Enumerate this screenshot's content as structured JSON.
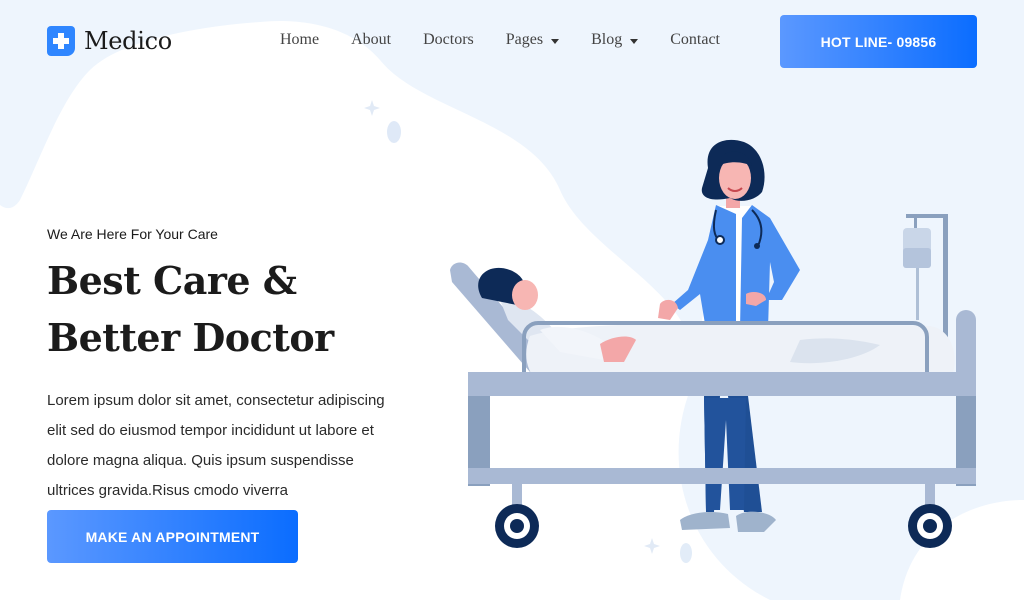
{
  "brand": {
    "name": "Medico",
    "icon": "medical-cross-icon"
  },
  "nav": {
    "items": [
      {
        "label": "Home",
        "dropdown": false
      },
      {
        "label": "About",
        "dropdown": false
      },
      {
        "label": "Doctors",
        "dropdown": false
      },
      {
        "label": "Pages",
        "dropdown": true
      },
      {
        "label": "Blog",
        "dropdown": true
      },
      {
        "label": "Contact",
        "dropdown": false
      }
    ]
  },
  "hotline": {
    "label": "HOT LINE- 09856"
  },
  "hero": {
    "subtitle": "We Are Here For Your Care",
    "title": "Best Care & Better Doctor",
    "description": "Lorem ipsum dolor sit amet, consectetur adipiscing elit sed do eiusmod tempor incididunt ut labore et dolore magna aliqua. Quis ipsum suspendisse ultrices gravida.Risus cmodo viverra",
    "cta_label": "MAKE AN APPOINTMENT"
  },
  "colors": {
    "accent_start": "#5b98ff",
    "accent_end": "#0b6dff",
    "background_tint": "#eef5fd",
    "bed": "#a9b9d4",
    "navy": "#0d2a57"
  }
}
